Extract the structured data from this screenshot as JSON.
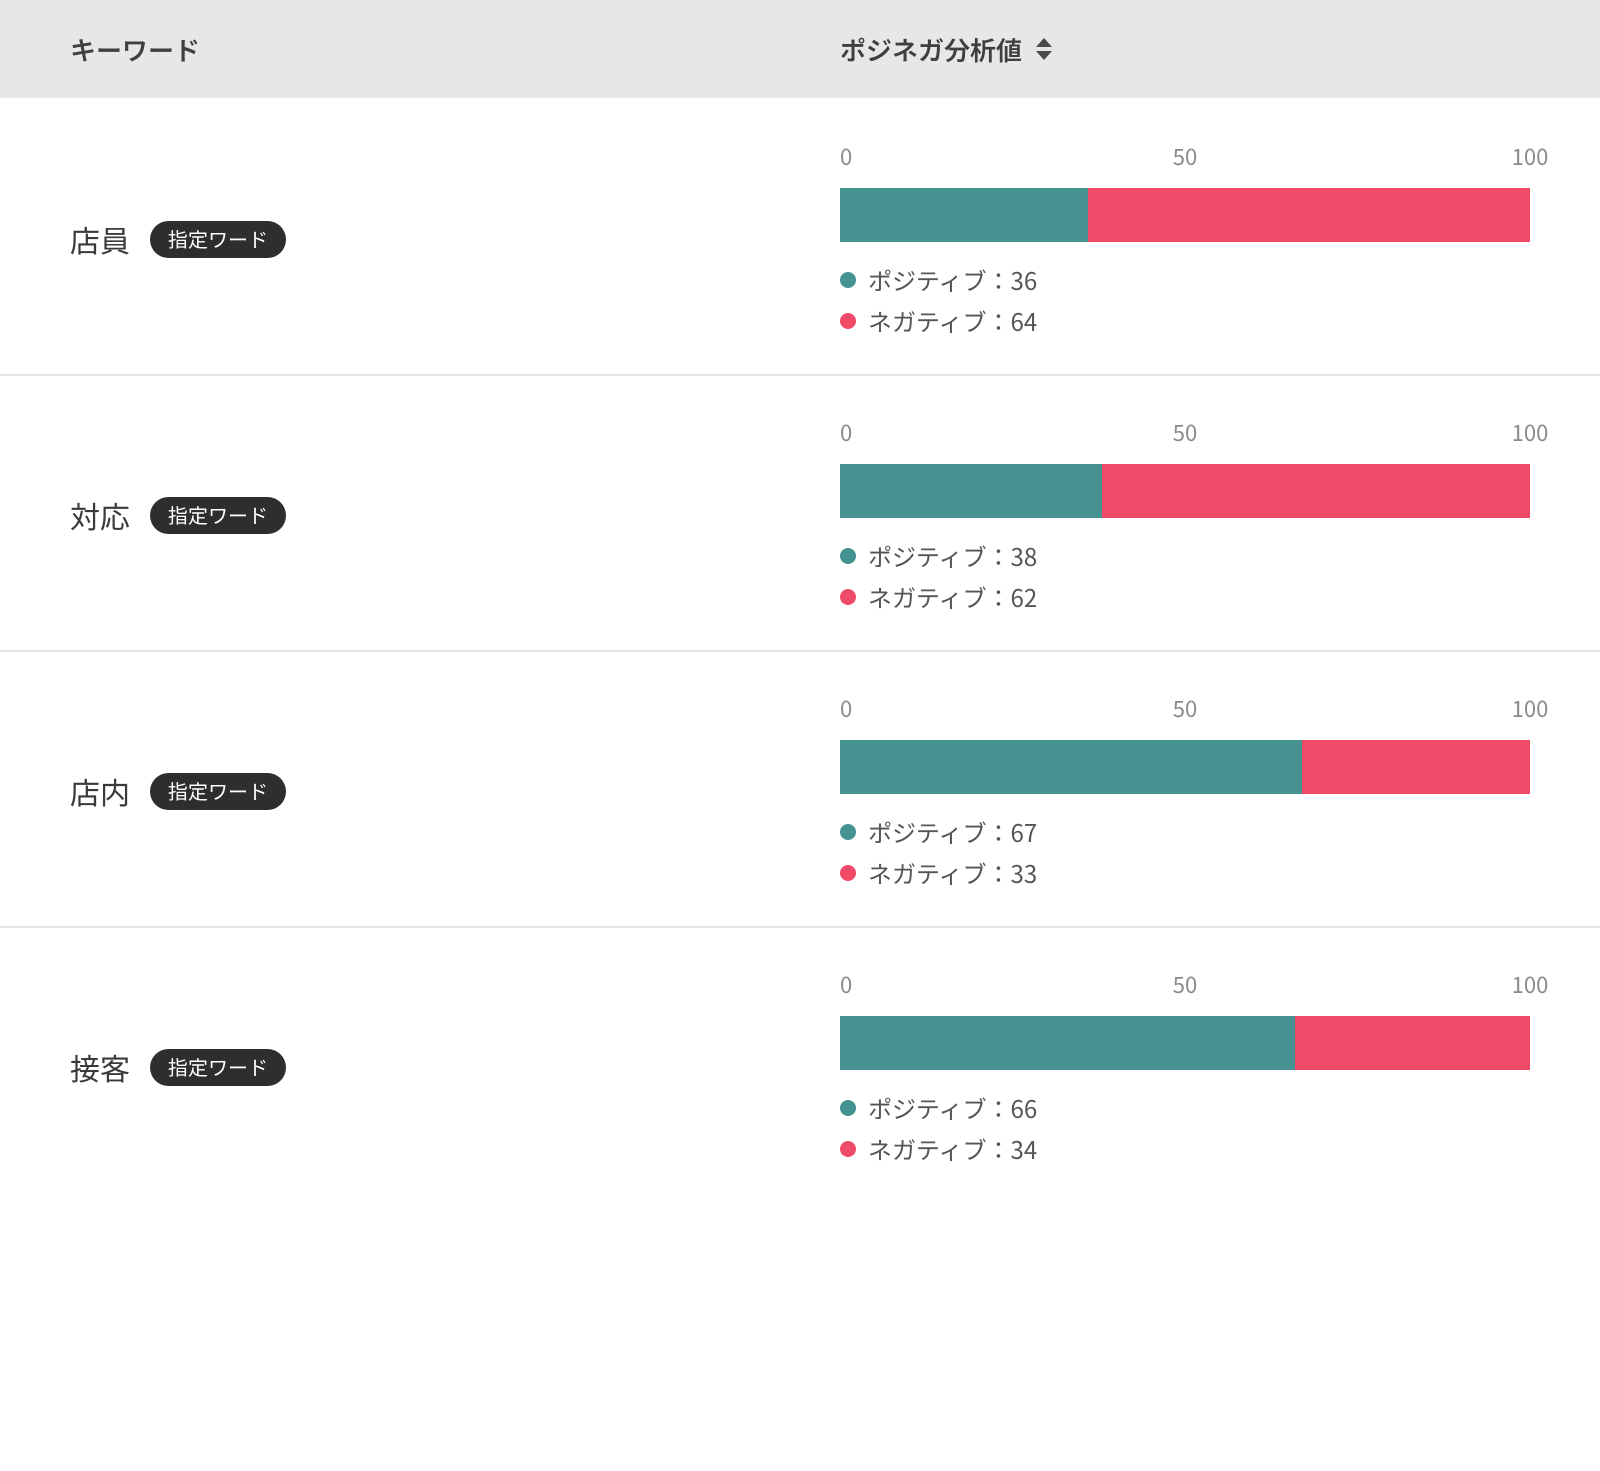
{
  "header": {
    "keyword_col": "キーワード",
    "value_col": "ポジネガ分析値"
  },
  "axis_ticks": {
    "t0": "0",
    "t50": "50",
    "t100": "100"
  },
  "legend_labels": {
    "positive": "ポジティブ",
    "negative": "ネガティブ"
  },
  "tag_label": "指定ワード",
  "rows": [
    {
      "keyword": "店員",
      "tag": true,
      "positive": 36,
      "negative": 64
    },
    {
      "keyword": "対応",
      "tag": true,
      "positive": 38,
      "negative": 62
    },
    {
      "keyword": "店内",
      "tag": true,
      "positive": 67,
      "negative": 33
    },
    {
      "keyword": "接客",
      "tag": true,
      "positive": 66,
      "negative": 34
    }
  ],
  "colors": {
    "positive": "#469290",
    "negative": "#ef4b68"
  },
  "chart_data": {
    "type": "bar",
    "orientation": "horizontal-stacked",
    "xlim": [
      0,
      100
    ],
    "xticks": [
      0,
      50,
      100
    ],
    "series": [
      {
        "name": "ポジティブ",
        "color": "#469290"
      },
      {
        "name": "ネガティブ",
        "color": "#ef4b68"
      }
    ],
    "categories": [
      "店員",
      "対応",
      "店内",
      "接客"
    ],
    "values": {
      "ポジティブ": [
        36,
        38,
        67,
        66
      ],
      "ネガティブ": [
        64,
        62,
        33,
        34
      ]
    },
    "title": "ポジネガ分析値",
    "xlabel": "",
    "ylabel": "キーワード"
  }
}
